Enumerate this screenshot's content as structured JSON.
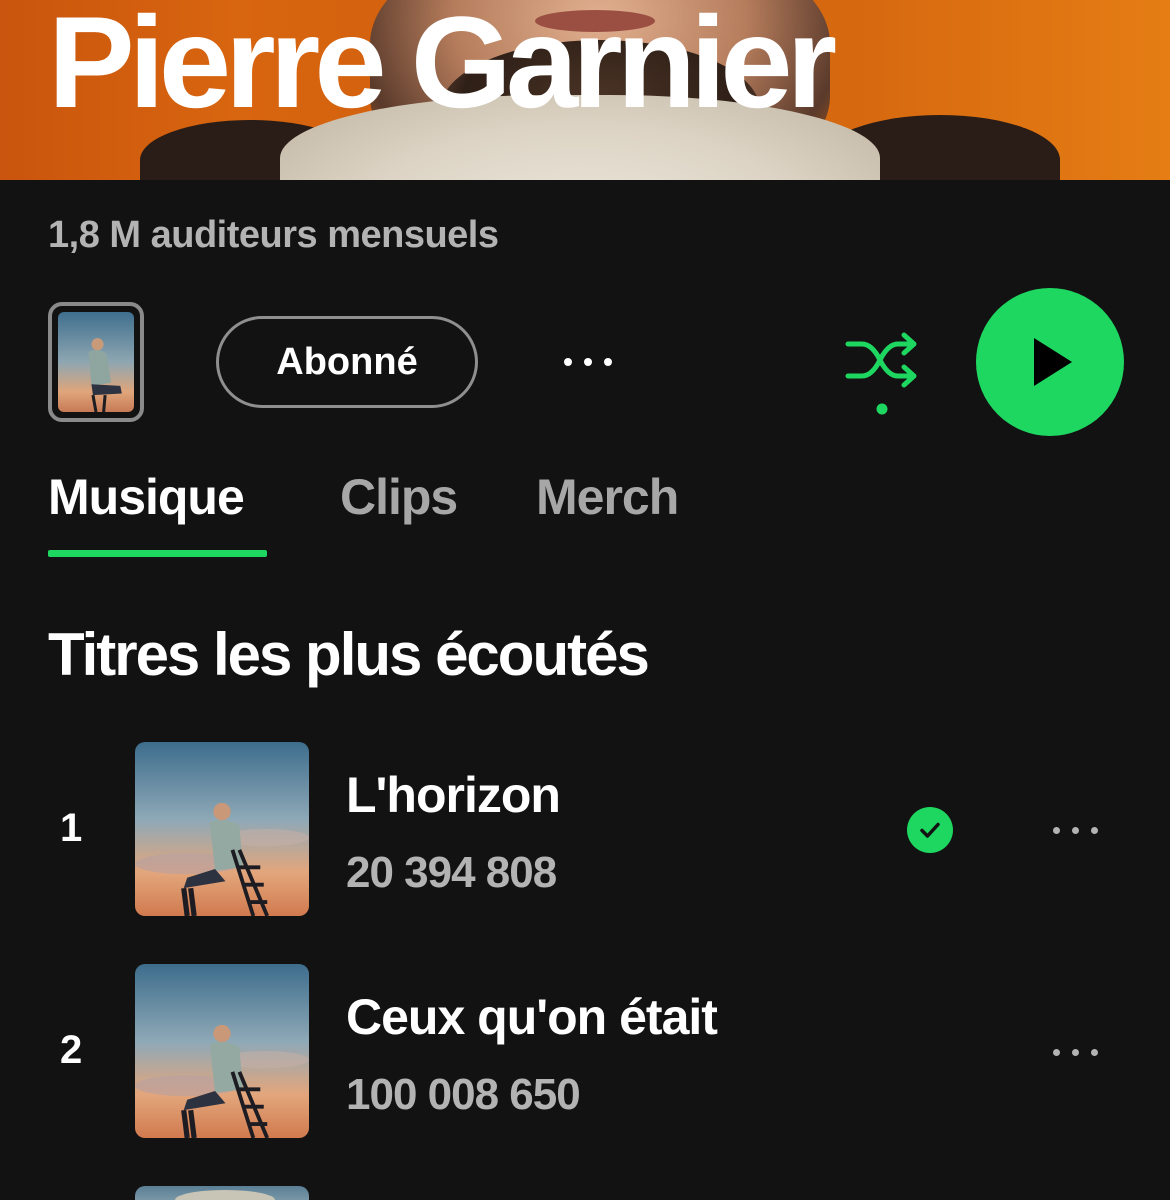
{
  "artist": {
    "name": "Pierre Garnier",
    "monthly_listeners": "1,8 M auditeurs mensuels"
  },
  "actions": {
    "follow_label": "Abonné",
    "shuffle_icon": "shuffle-icon",
    "play_icon": "play-icon",
    "accent_color": "#1ed760"
  },
  "tabs": [
    {
      "label": "Musique",
      "active": true
    },
    {
      "label": "Clips",
      "active": false
    },
    {
      "label": "Merch",
      "active": false
    }
  ],
  "popular": {
    "title": "Titres les plus écoutés",
    "tracks": [
      {
        "rank": "1",
        "title": "L'horizon",
        "plays": "20 394 808",
        "saved": true
      },
      {
        "rank": "2",
        "title": "Ceux qu'on était",
        "plays": "100 008 650",
        "saved": false
      }
    ]
  }
}
